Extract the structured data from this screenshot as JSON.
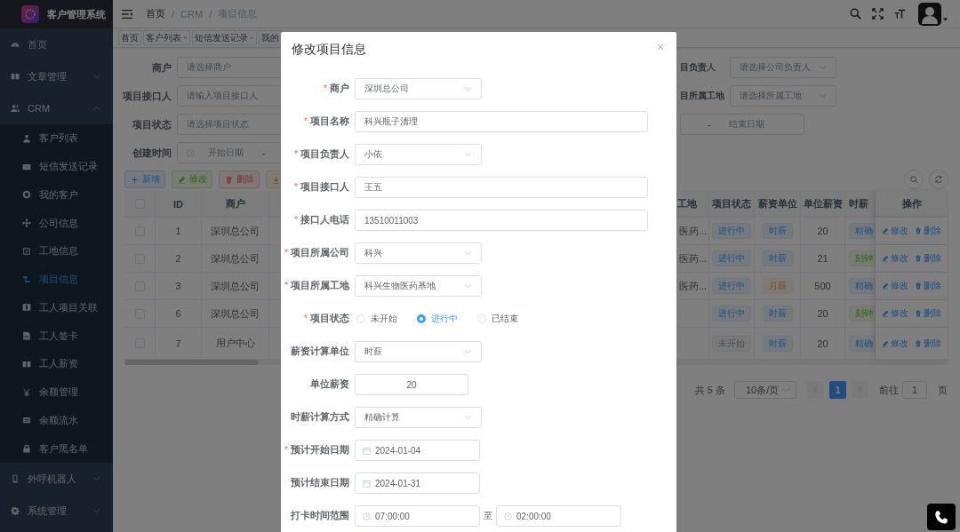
{
  "sidebar": {
    "logo_title": "客户管理系统",
    "items": [
      {
        "label": "首页",
        "selected": false
      },
      {
        "label": "文章管理",
        "selected": false,
        "expanded": false
      },
      {
        "label": "CRM",
        "selected": false,
        "expanded": true,
        "children": [
          {
            "label": "客户列表",
            "selected": false
          },
          {
            "label": "短信发送记录",
            "selected": false
          },
          {
            "label": "我的客户",
            "selected": false
          },
          {
            "label": "公司信息",
            "selected": false
          },
          {
            "label": "工地信息",
            "selected": false
          },
          {
            "label": "项目信息",
            "selected": true
          },
          {
            "label": "工人项目关联",
            "selected": false
          },
          {
            "label": "工人签卡",
            "selected": false
          },
          {
            "label": "工人薪资",
            "selected": false
          },
          {
            "label": "余额管理",
            "selected": false
          },
          {
            "label": "余额流水",
            "selected": false
          },
          {
            "label": "客户黑名单",
            "selected": false
          }
        ]
      },
      {
        "label": "外呼机器人",
        "selected": false,
        "expanded": false
      },
      {
        "label": "系统管理",
        "selected": false,
        "expanded": false
      }
    ]
  },
  "breadcrumb": {
    "separator": "/",
    "items": [
      "首页",
      "CRM",
      "项目信息"
    ]
  },
  "tags_view": [
    {
      "label": "首页",
      "closable": false
    },
    {
      "label": "客户列表",
      "closable": true
    },
    {
      "label": "短信发送记录",
      "closable": true
    },
    {
      "label": "我的"
    }
  ],
  "filters": [
    {
      "left": {
        "label": "商户",
        "kind": "select",
        "placeholder": "请选择商户"
      },
      "right": {
        "label": "目负责人",
        "kind": "select",
        "placeholder": "请选择公司负责人"
      }
    },
    {
      "left": {
        "label": "项目接口人",
        "kind": "input",
        "placeholder": "请输入项目接口人"
      },
      "right": {
        "label": "目所属工地",
        "kind": "select",
        "placeholder": "请选择所属工地"
      }
    },
    {
      "left": {
        "label": "项目状态",
        "kind": "select",
        "placeholder": "请选择项目状态"
      },
      "right": {
        "kind": "range_end",
        "separator": "-",
        "placeholder": "结束日期"
      }
    },
    {
      "left": {
        "label": "创建时间",
        "kind": "range_start",
        "placeholder": "开始日期",
        "separator": "-"
      }
    }
  ],
  "toolbar": [
    {
      "label": "新增",
      "kind": "primary"
    },
    {
      "label": "修改",
      "kind": "success"
    },
    {
      "label": "删除",
      "kind": "danger"
    },
    {
      "kind": "warning"
    }
  ],
  "table": {
    "header_checked": false,
    "columns": [
      "ID",
      "商户",
      "工地",
      "项目状态",
      "薪资单位",
      "单位薪资",
      "时薪",
      "操作"
    ],
    "rows": [
      {
        "checked": false,
        "id": "1",
        "merchant": "深圳总公司",
        "site": "医药...",
        "status": {
          "text": "进行中",
          "kind": "primary"
        },
        "pay_unit": {
          "text": "时薪",
          "kind": "primary"
        },
        "pay": "20",
        "wage_method": {
          "text": "精确",
          "kind": "primary"
        },
        "actions": [
          "修改",
          "删除"
        ]
      },
      {
        "checked": false,
        "id": "2",
        "merchant": "深圳总公司",
        "site": "医药...",
        "status": {
          "text": "进行中",
          "kind": "primary"
        },
        "pay_unit": {
          "text": "时薪",
          "kind": "primary"
        },
        "pay": "21",
        "wage_method": {
          "text": "刻钟",
          "kind": "success"
        },
        "actions": [
          "修改",
          "删除"
        ]
      },
      {
        "checked": false,
        "id": "3",
        "merchant": "深圳总公司",
        "site": "医药...",
        "status": {
          "text": "进行中",
          "kind": "primary"
        },
        "pay_unit": {
          "text": "月薪",
          "kind": "warning"
        },
        "pay": "500",
        "wage_method": {
          "text": "精确",
          "kind": "primary"
        },
        "actions": [
          "修改",
          "删除"
        ]
      },
      {
        "checked": false,
        "id": "6",
        "merchant": "深圳总公司",
        "status": {
          "text": "进行中",
          "kind": "primary"
        },
        "pay_unit": {
          "text": "时薪",
          "kind": "primary"
        },
        "pay": "20",
        "wage_method": {
          "text": "刻钟",
          "kind": "success"
        },
        "actions": [
          "修改",
          "删除"
        ]
      },
      {
        "checked": false,
        "id": "7",
        "merchant": "用户中心",
        "status": {
          "text": "未开始",
          "kind": "info"
        },
        "pay_unit": {
          "text": "时薪",
          "kind": "primary"
        },
        "pay": "20",
        "wage_method": {
          "text": "精确",
          "kind": "primary"
        },
        "actions": [
          "修改",
          "删除"
        ]
      }
    ]
  },
  "pagination": {
    "total": "共 5 条",
    "page_size": "10条/页",
    "pages": [
      {
        "label": "1",
        "selected": true
      }
    ],
    "goto_label": "前往",
    "goto_value": "1",
    "goto_suffix": "页"
  },
  "dialog": {
    "title": "修改项目信息",
    "required_mark": "*",
    "fields": [
      {
        "label": "商户",
        "required": true,
        "kind": "select",
        "value": "深圳总公司"
      },
      {
        "label": "项目名称",
        "required": true,
        "kind": "input",
        "value": "科兴瓶子清理"
      },
      {
        "label": "项目负责人",
        "required": true,
        "kind": "select",
        "value": "小依"
      },
      {
        "label": "项目接口人",
        "required": true,
        "kind": "input",
        "value": "王五"
      },
      {
        "label": "接口人电话",
        "required": true,
        "kind": "input",
        "value": "13510011003"
      },
      {
        "label": "项目所属公司",
        "required": true,
        "kind": "select",
        "value": "科兴"
      },
      {
        "label": "项目所属工地",
        "required": true,
        "kind": "select",
        "value": "科兴生物医药基地"
      },
      {
        "label": "项目状态",
        "required": true,
        "kind": "radio",
        "options": [
          {
            "label": "未开始",
            "selected": false
          },
          {
            "label": "进行中",
            "selected": true
          },
          {
            "label": "已结束",
            "selected": false
          }
        ]
      },
      {
        "label": "薪资计算单位",
        "required": false,
        "kind": "select",
        "value": "时薪"
      },
      {
        "label": "单位薪资",
        "required": false,
        "kind": "number",
        "value": "20"
      },
      {
        "label": "时薪计算方式",
        "required": false,
        "kind": "select",
        "value": "精确计算"
      },
      {
        "label": "预计开始日期",
        "required": true,
        "kind": "date",
        "value": "2024-01-04"
      },
      {
        "label": "预计结束日期",
        "required": false,
        "kind": "date",
        "value": "2024-01-31"
      },
      {
        "label": "打卡时间范围",
        "required": false,
        "kind": "timerange",
        "start": "07:00:00",
        "separator": "至",
        "end": "02:00:00"
      }
    ]
  }
}
